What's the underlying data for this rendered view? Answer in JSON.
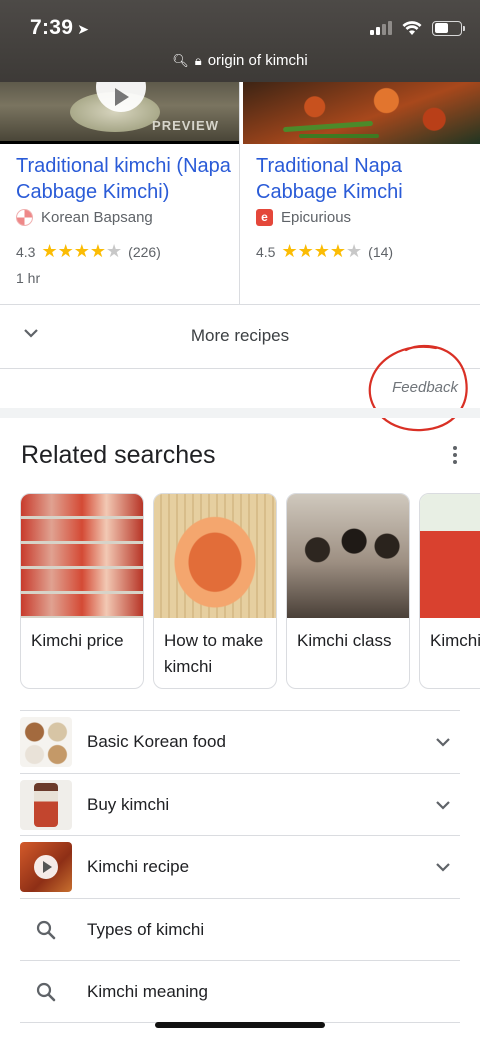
{
  "status": {
    "time": "7:39",
    "location_glyph": "➤"
  },
  "url": {
    "text": "origin of kimchi"
  },
  "recipes": [
    {
      "title": "Traditional kimchi (Napa Cabbage Kimchi)",
      "source": "Korean Bapsang",
      "rating": "4.3",
      "reviews": "(226)",
      "time": "1 hr",
      "overlay": "PREVIEW",
      "stars": 4.3
    },
    {
      "title": "Traditional Napa Cabbage Kimchi",
      "source": "Epicurious",
      "source_icon_letter": "e",
      "rating": "4.5",
      "reviews": "(14)",
      "stars": 4.5
    }
  ],
  "more_recipes": {
    "label": "More recipes"
  },
  "feedback": {
    "label": "Feedback"
  },
  "related": {
    "title": "Related searches",
    "chips": [
      {
        "label": "Kimchi price"
      },
      {
        "label": "How to make kimchi"
      },
      {
        "label": "Kimchi class"
      },
      {
        "label": "Kimchi AEON"
      }
    ],
    "list": [
      {
        "label": "Basic Korean food"
      },
      {
        "label": "Buy kimchi"
      },
      {
        "label": "Kimchi recipe"
      },
      {
        "label": "Types of kimchi"
      },
      {
        "label": "Kimchi meaning"
      }
    ]
  },
  "colors": {
    "link": "#2a5bd7",
    "star": "#fbbc04",
    "annotation": "#d93025"
  }
}
